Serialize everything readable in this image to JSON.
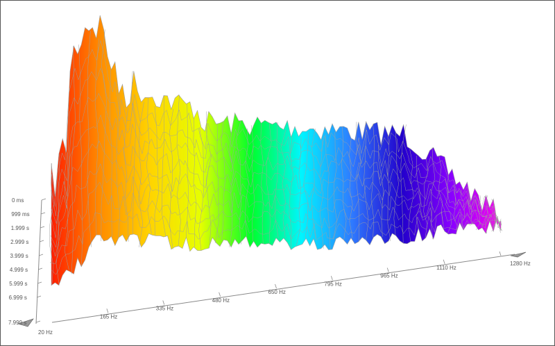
{
  "chart_data": {
    "type": "waterfall-3d-spectrogram",
    "x_axis": {
      "ticks": [
        "20 Hz",
        "165 Hz",
        "335 Hz",
        "480 Hz",
        "650 Hz",
        "795 Hz",
        "965 Hz",
        "1110 Hz",
        "1280 Hz"
      ],
      "range_hz": [
        20,
        1280
      ]
    },
    "z_axis": {
      "ticks": [
        "0 ms",
        "999 ms",
        "1.999 s",
        "2.999 s",
        "3.999 s",
        "4.999 s",
        "5.999 s",
        "6.999 s",
        "7.999 s"
      ],
      "range_s": [
        0,
        7.999
      ]
    },
    "colors": {
      "spectrum": [
        "#ff1a00",
        "#ff8c00",
        "#ffd400",
        "#e6ff00",
        "#00ff2a",
        "#00f5ff",
        "#2f7bff",
        "#2200cc",
        "#8a00ff",
        "#ff00f0"
      ],
      "mesh_line": "#a0a0a0",
      "axis": "#888888"
    }
  }
}
